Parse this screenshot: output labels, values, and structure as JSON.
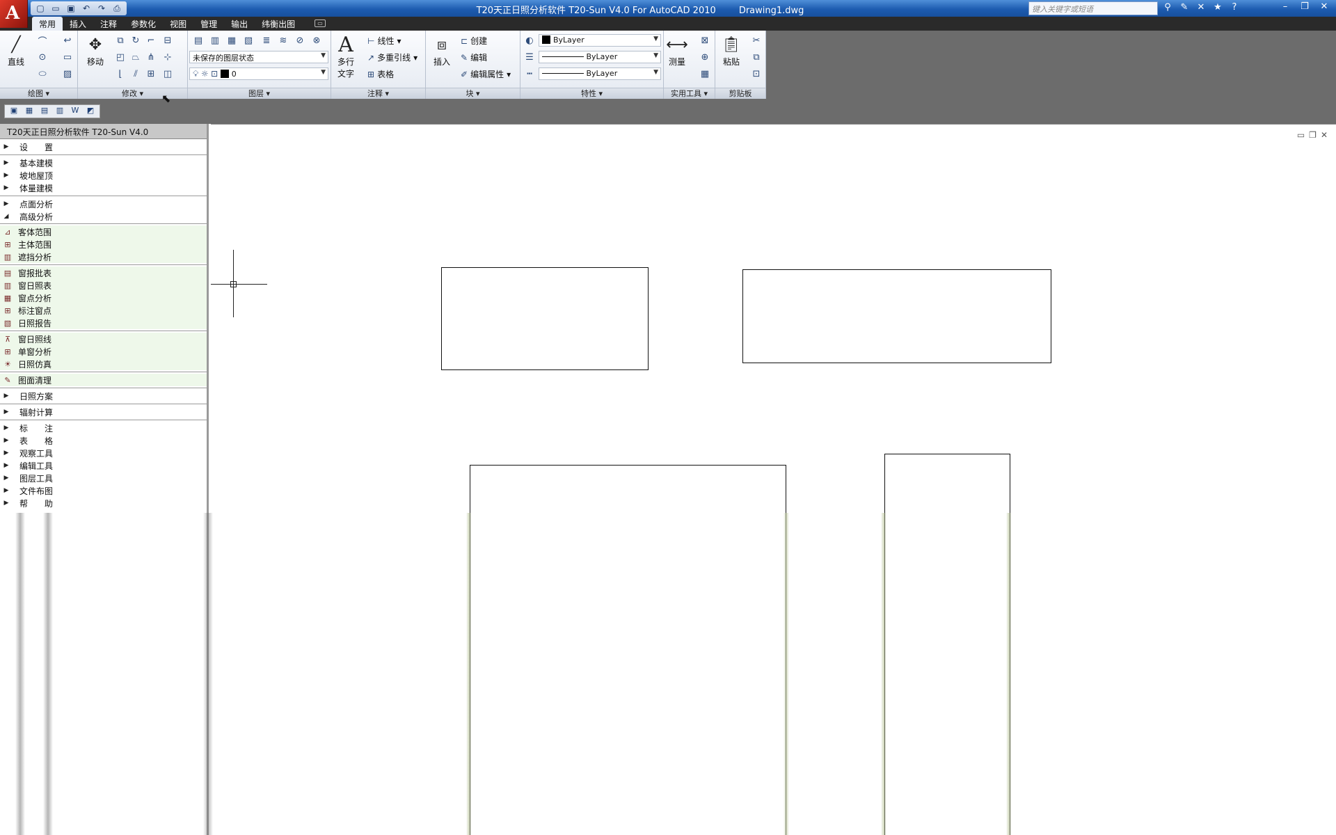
{
  "app": {
    "title": "T20天正日照分析软件 T20-Sun V4.0 For AutoCAD 2010        Drawing1.dwg",
    "logo": "A",
    "search_placeholder": "键入关键字或短语"
  },
  "quick_access": [
    "new-icon",
    "open-icon",
    "save-icon",
    "undo-icon",
    "redo-icon",
    "print-icon"
  ],
  "ribbon_tabs": [
    "常用",
    "插入",
    "注释",
    "参数化",
    "视图",
    "管理",
    "输出",
    "纬衡出图"
  ],
  "active_tab": "常用",
  "panels": {
    "draw": {
      "label": "绘图",
      "line_btn": "直线"
    },
    "modify": {
      "label": "修改",
      "move_btn": "移动"
    },
    "layers": {
      "label": "图层",
      "layer_state": "未保存的图层状态",
      "current_layer": "0"
    },
    "annotation": {
      "label": "注释",
      "mtext_line1": "多行",
      "mtext_line2": "文字",
      "linear": "线性",
      "mleader": "多重引线",
      "table": "表格"
    },
    "block": {
      "label": "块",
      "insert": "插入",
      "create": "创建",
      "edit": "编辑",
      "edit_attr": "编辑属性"
    },
    "properties": {
      "label": "特性",
      "color": "ByLayer",
      "linetype": "ByLayer",
      "lineweight": "ByLayer"
    },
    "utilities": {
      "label": "实用工具",
      "measure": "测量"
    },
    "clipboard": {
      "label": "剪贴板",
      "paste": "粘贴"
    }
  },
  "palette": {
    "title": "T20天正日照分析软件 T20-Sun V4.0",
    "groups": [
      {
        "label": "设　　置",
        "expanded": false
      },
      {
        "label": "基本建模",
        "expanded": false
      },
      {
        "label": "坡地屋顶",
        "expanded": false
      },
      {
        "label": "体量建模",
        "expanded": false
      },
      {
        "label": "点面分析",
        "expanded": false
      },
      {
        "label": "高级分析",
        "expanded": true
      }
    ],
    "advanced_items_a": [
      "客体范围",
      "主体范围",
      "遮挡分析"
    ],
    "advanced_items_b": [
      "窗报批表",
      "窗日照表",
      "窗点分析",
      "标注窗点",
      "日照报告"
    ],
    "advanced_items_c": [
      "窗日照线",
      "单窗分析",
      "日照仿真"
    ],
    "advanced_items_d": [
      "图面清理"
    ],
    "groups_after": [
      "日照方案",
      "辐射计算"
    ],
    "groups_tail": [
      "标　　注",
      "表　　格",
      "观察工具",
      "编辑工具",
      "图层工具",
      "文件布图",
      "帮　　助"
    ]
  },
  "colors": {
    "title_bar": "#1d5cb0",
    "ribbon_bg": "#e9eef6",
    "palette_highlight": "#eef8ea",
    "workspace_bg": "#6c6c6c"
  }
}
